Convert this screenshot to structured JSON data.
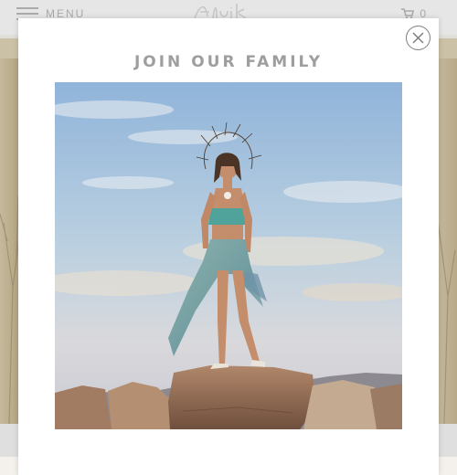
{
  "header": {
    "menu_label": "MENU",
    "cart_count": "0",
    "icons": {
      "menu": "hamburger-icon",
      "cart": "cart-icon",
      "logo": "script-logo"
    }
  },
  "popup": {
    "title": "JOIN OUR FAMILY",
    "close_icon": "close-icon",
    "image": {
      "subject": "woman standing on boulders in a desert at dusk, wearing a teal bandeau top and flowing scarf skirt"
    }
  },
  "colors": {
    "header_bg": "#fafafa",
    "announce_bar": "#ddd2b6",
    "title_text": "#9e9e9e",
    "modal_bg": "#ffffff",
    "close_ring": "#7d7d7d"
  }
}
